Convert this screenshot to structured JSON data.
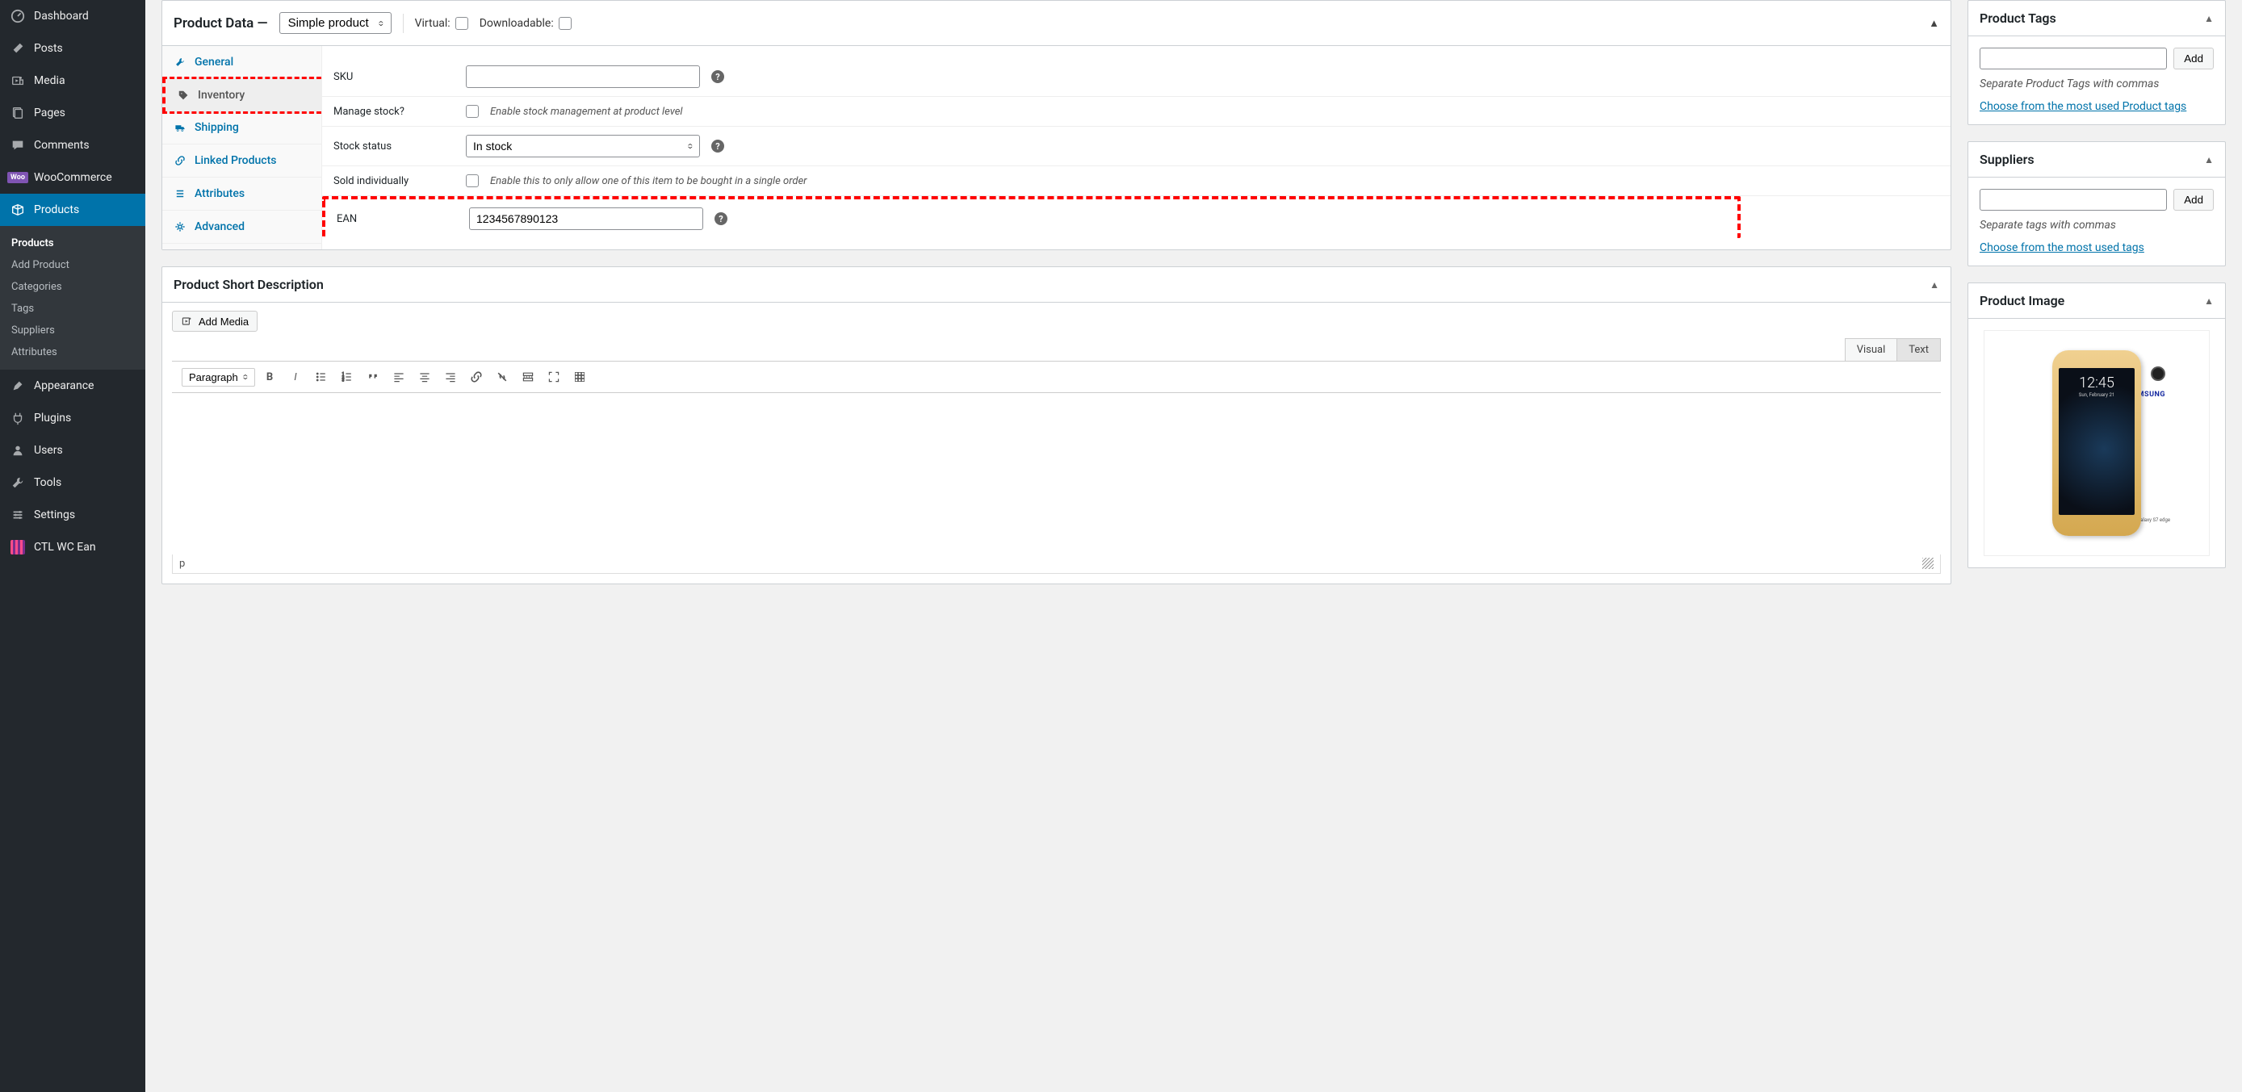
{
  "sidebar": {
    "items": [
      {
        "label": "Dashboard",
        "icon": "dashboard"
      },
      {
        "label": "Posts",
        "icon": "pin"
      },
      {
        "label": "Media",
        "icon": "media"
      },
      {
        "label": "Pages",
        "icon": "pages"
      },
      {
        "label": "Comments",
        "icon": "comments"
      },
      {
        "label": "WooCommerce",
        "icon": "woo"
      },
      {
        "label": "Products",
        "icon": "products",
        "active": true
      },
      {
        "label": "Appearance",
        "icon": "appearance"
      },
      {
        "label": "Plugins",
        "icon": "plugins"
      },
      {
        "label": "Users",
        "icon": "users"
      },
      {
        "label": "Tools",
        "icon": "tools"
      },
      {
        "label": "Settings",
        "icon": "settings"
      },
      {
        "label": "CTL WC Ean",
        "icon": "ctl"
      }
    ],
    "sub": [
      {
        "label": "Products",
        "current": true
      },
      {
        "label": "Add Product"
      },
      {
        "label": "Categories"
      },
      {
        "label": "Tags"
      },
      {
        "label": "Suppliers"
      },
      {
        "label": "Attributes"
      }
    ]
  },
  "product_data": {
    "title": "Product Data —",
    "type_selected": "Simple product",
    "virtual_label": "Virtual:",
    "downloadable_label": "Downloadable:",
    "tabs": [
      {
        "label": "General",
        "icon": "wrench"
      },
      {
        "label": "Inventory",
        "icon": "tag",
        "active": true,
        "highlight": true
      },
      {
        "label": "Shipping",
        "icon": "truck"
      },
      {
        "label": "Linked Products",
        "icon": "link"
      },
      {
        "label": "Attributes",
        "icon": "list"
      },
      {
        "label": "Advanced",
        "icon": "gear"
      }
    ],
    "fields": {
      "sku_label": "SKU",
      "sku_value": "",
      "manage_stock_label": "Manage stock?",
      "manage_stock_hint": "Enable stock management at product level",
      "stock_status_label": "Stock status",
      "stock_status_value": "In stock",
      "sold_individually_label": "Sold individually",
      "sold_individually_hint": "Enable this to only allow one of this item to be bought in a single order",
      "ean_label": "EAN",
      "ean_value": "1234567890123"
    }
  },
  "short_desc": {
    "title": "Product Short Description",
    "add_media": "Add Media",
    "tab_visual": "Visual",
    "tab_text": "Text",
    "format_select": "Paragraph",
    "footer_path": "p"
  },
  "tags_box": {
    "title": "Product Tags",
    "add": "Add",
    "note": "Separate Product Tags with commas",
    "link": "Choose from the most used Product tags"
  },
  "suppliers_box": {
    "title": "Suppliers",
    "add": "Add",
    "note": "Separate tags with commas",
    "link": "Choose from the most used tags"
  },
  "image_box": {
    "title": "Product Image",
    "phone_time": "12:45",
    "phone_date": "Sun, February 21",
    "phone_brand": "SAMSUNG",
    "phone_model": "Galaxy S7 edge"
  }
}
